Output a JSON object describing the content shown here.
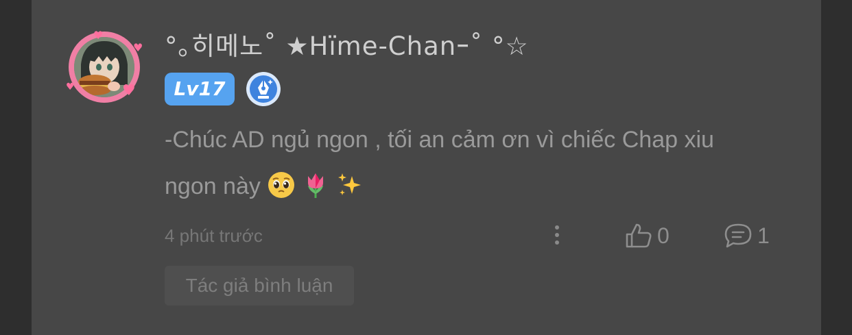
{
  "comment": {
    "username": "°｡히메노˚ ★Hïmе-Cհanｰ˚ °☆",
    "level_label": "Lv17",
    "badge_icon": "pen-badge-icon",
    "text_line1": "-Chúc AD ngủ ngon , tối an cảm ơn vì chiếc Chap xiu",
    "text_line2": "ngon này",
    "emojis": [
      "pleading-face-emoji",
      "tulip-emoji",
      "sparkles-emoji"
    ],
    "timestamp": "4 phút trước",
    "like_count": "0",
    "reply_count": "1",
    "author_tag": "Tác giả bình luận"
  },
  "colors": {
    "background": "#2e2e2e",
    "panel": "#474747",
    "level_badge": "#56a3f0",
    "avatar_ring": "#f07fa5",
    "text_muted": "#9a9a9a"
  }
}
